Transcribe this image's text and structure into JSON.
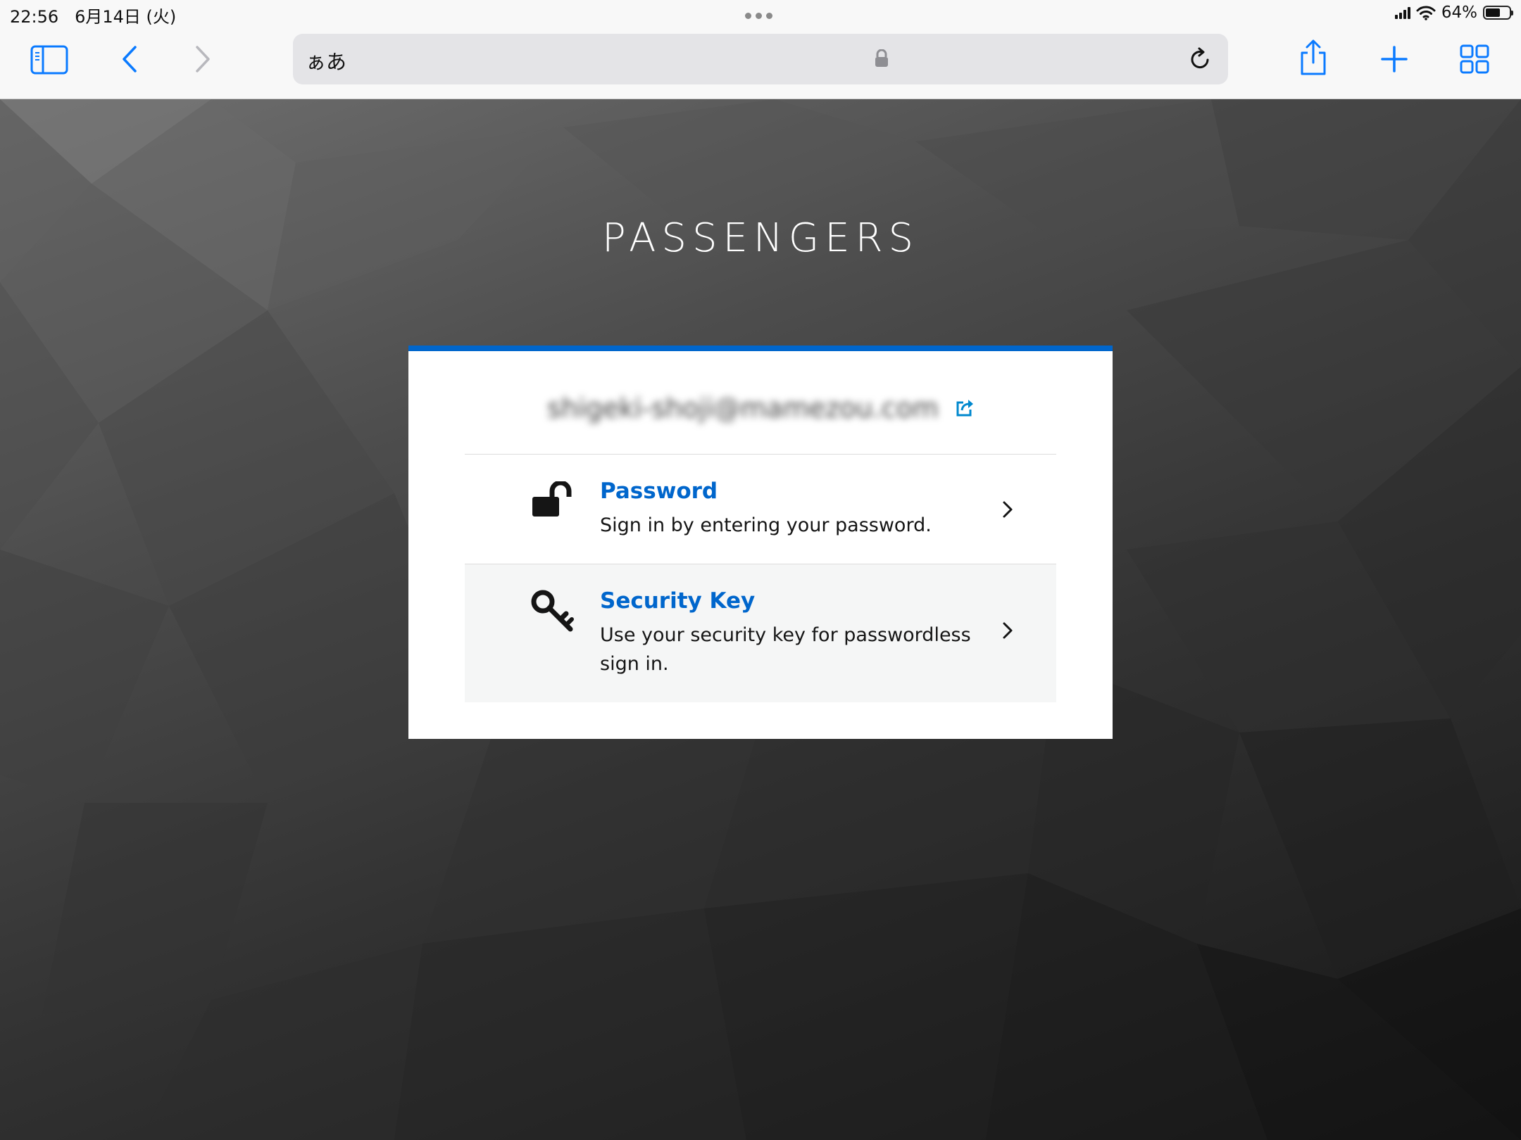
{
  "status_bar": {
    "time": "22:56",
    "date": "6月14日 (火)",
    "battery": "64%",
    "battery_level": 0.64
  },
  "browser": {
    "text_size_button": "ぁあ",
    "icons": {
      "sidebar": "sidebar-icon",
      "back": "chevron-left-icon",
      "forward": "chevron-right-icon",
      "lock": "lock-icon",
      "reload": "reload-icon",
      "share": "share-icon",
      "new_tab": "plus-icon",
      "tabs": "tab-grid-icon"
    }
  },
  "page": {
    "brand": "PASSENGERS",
    "user_email": "shigeki-shoji@mamezou.com",
    "accent_color": "#0066cc",
    "options": [
      {
        "title": "Password",
        "description": "Sign in by entering your password.",
        "icon": "unlock-icon"
      },
      {
        "title": "Security Key",
        "description": "Use your security key for passwordless sign in.",
        "icon": "key-icon"
      }
    ]
  }
}
